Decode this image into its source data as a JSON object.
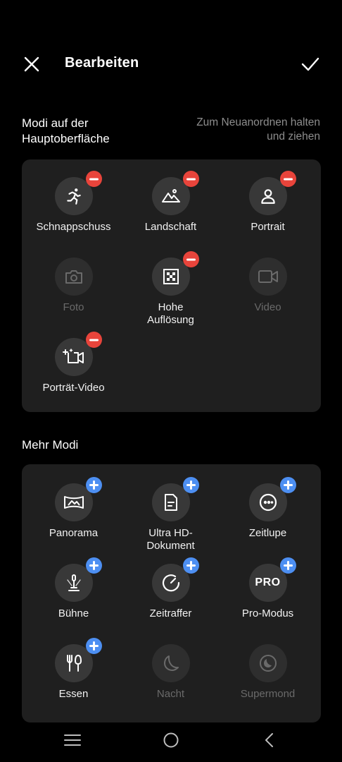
{
  "header": {
    "title": "Bearbeiten"
  },
  "main_modes": {
    "label": "Modi auf der Hauptoberfläche",
    "hint": "Zum Neuanordnen halten und ziehen",
    "items": [
      {
        "label": "Schnappschuss",
        "icon": "running-person-icon",
        "state": "active"
      },
      {
        "label": "Landschaft",
        "icon": "landscape-icon",
        "state": "active"
      },
      {
        "label": "Portrait",
        "icon": "person-icon",
        "state": "active"
      },
      {
        "label": "Foto",
        "icon": "camera-icon",
        "state": "disabled"
      },
      {
        "label": "Hohe Auflösung",
        "icon": "high-resolution-icon",
        "state": "active"
      },
      {
        "label": "Video",
        "icon": "video-camera-icon",
        "state": "disabled"
      },
      {
        "label": "Porträt-Video",
        "icon": "portrait-video-icon",
        "state": "active"
      }
    ]
  },
  "more_modes": {
    "label": "Mehr Modi",
    "items": [
      {
        "label": "Panorama",
        "icon": "panorama-icon",
        "state": "available"
      },
      {
        "label": "Ultra HD-Dokument",
        "icon": "document-icon",
        "state": "available"
      },
      {
        "label": "Zeitlupe",
        "icon": "slow-motion-icon",
        "state": "available"
      },
      {
        "label": "Bühne",
        "icon": "stage-icon",
        "state": "available"
      },
      {
        "label": "Zeitraffer",
        "icon": "timelapse-icon",
        "state": "available"
      },
      {
        "label": "Pro-Modus",
        "icon": "pro-icon",
        "icon_text": "PRO",
        "state": "available"
      },
      {
        "label": "Essen",
        "icon": "food-icon",
        "state": "available"
      },
      {
        "label": "Nacht",
        "icon": "moon-icon",
        "state": "disabled"
      },
      {
        "label": "Supermond",
        "icon": "supermoon-icon",
        "state": "disabled"
      }
    ]
  },
  "colors": {
    "remove_badge": "#e8443b",
    "add_badge": "#4d8ff2",
    "panel": "#1f1f1f",
    "tile": "#383838"
  }
}
